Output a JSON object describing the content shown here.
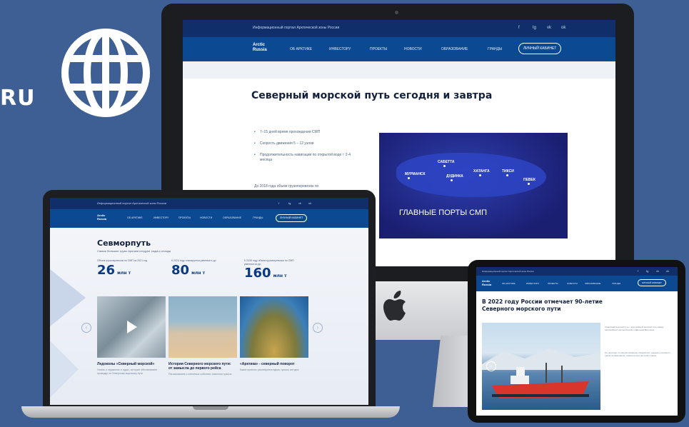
{
  "brand": {
    "text": "RU"
  },
  "colors": {
    "background": "#3e5f93",
    "site_navy": "#0b4a92",
    "site_topbar": "#102f6a"
  },
  "imac": {
    "site": {
      "crumb": "Информационный портал Арктической зоны России",
      "social": [
        "f",
        "tg",
        "vk",
        "ok"
      ],
      "logo": [
        "Arctic",
        "Russia"
      ],
      "nav": [
        "ОБ АРКТИКЕ",
        "ИНВЕСТОРУ",
        "ПРОЕКТЫ",
        "НОВОСТИ",
        "ОБРАЗОВАНИЕ",
        "ГРАНДЫ"
      ],
      "cta": "ЛИЧНЫЙ КАБИНЕТ"
    },
    "title": "Северный морской путь сегодня и завтра",
    "bullets": [
      "7–15 дней время прохождения СМП",
      "Скорость движения 5 – 12 узлов",
      "Продолжительность навигации по открытой воде ≈ 2-4 месяца"
    ],
    "footnote": "До 2018 года объем грузоперевозок по",
    "map": {
      "caption": "ГЛАВНЫЕ ПОРТЫ СМП",
      "cities": [
        "МУРМАНСК",
        "САБЕТТА",
        "ДУДИНКА",
        "ХАТАНГА",
        "ТИКСИ",
        "ПЕВЕК"
      ]
    }
  },
  "macbook": {
    "site": {
      "crumb": "Информационный портал Арктической зоны России",
      "social": [
        "f",
        "tg",
        "vk",
        "ok"
      ],
      "logo": [
        "Arctic",
        "Russia"
      ],
      "nav": [
        "ОБ АРКТИКЕ",
        "ИНВЕСТОРУ",
        "ПРОЕКТЫ",
        "НОВОСТИ",
        "ОБРАЗОВАНИЕ",
        "ГРАНДЫ"
      ],
      "cta": "ЛИЧНЫЙ КАБИНЕТ"
    },
    "title": "Севморпуть",
    "subtitle": "Самые большие грузы Арктики следуют сюда и отсюда",
    "stats": [
      {
        "label": "Объем грузоперевозок по СМП за 2021 год",
        "value": "26",
        "unit": "млн т"
      },
      {
        "label": "К 2024 году планируется увеличить до",
        "value": "80",
        "unit": "млн т"
      },
      {
        "label": "К 2035 году объем грузоперевозок по СМП увеличится до",
        "value": "160",
        "unit": "млн т"
      }
    ],
    "cards": [
      {
        "caption": "Ледоколы «Северный морской»",
        "text": "Узнать о ледоколах и судах, которые обеспечивают проводку по Северному морскому пути"
      },
      {
        "caption": "История Северного морского пути: от замысла до первого рейса",
        "text": "Рассказываем о ключевых событиях освоения трассы"
      },
      {
        "caption": "«Арктика» - северный поворот",
        "text": "Какие проекты реализуются вдоль трассы сегодня"
      }
    ]
  },
  "tablet": {
    "site": {
      "crumb": "Информационный портал Арктической зоны России",
      "social": [
        "f",
        "tg",
        "vk",
        "ok"
      ],
      "logo": [
        "Arctic",
        "Russia"
      ],
      "nav": [
        "ОБ АРКТИКЕ",
        "ИНВЕСТОРУ",
        "ПРОЕКТЫ",
        "НОВОСТИ",
        "ОБРАЗОВАНИЕ",
        "ГРАНДЫ"
      ],
      "cta": "ЛИЧНЫЙ КАБИНЕТ"
    },
    "title": "В 2022 году России отмечает 90-летие Северного морского пути",
    "paragraphs": [
      "Северный морской путь – кратчайший морской путь между европейской частью России и Дальним Востоком.",
      "Он проходит по морям Северного Ледовитого океана и считается одной из важнейших транспортных артерий страны."
    ]
  }
}
